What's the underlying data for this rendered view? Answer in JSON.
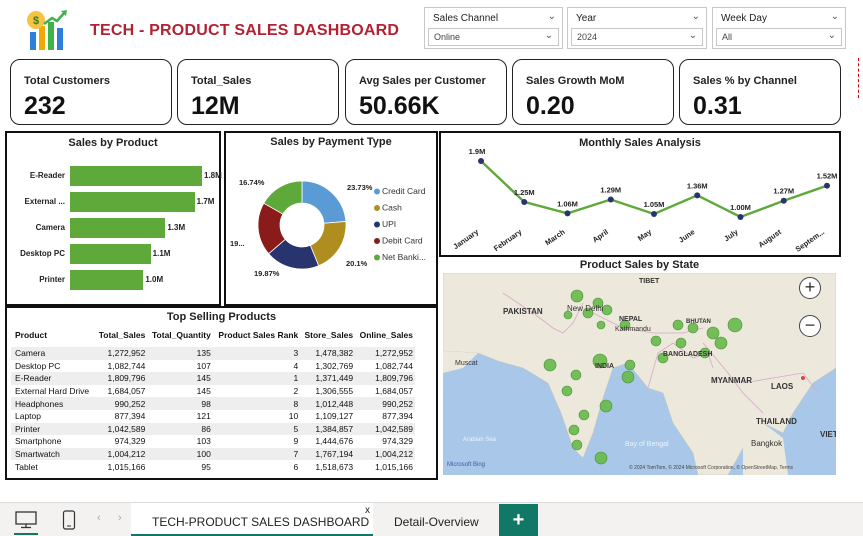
{
  "header": {
    "title": "TECH - PRODUCT SALES DASHBOARD"
  },
  "slicers": [
    {
      "label": "Sales Channel",
      "value": "Online"
    },
    {
      "label": "Year",
      "value": "2024"
    },
    {
      "label": "Week Day",
      "value": "All"
    }
  ],
  "kpis": [
    {
      "label": "Total Customers",
      "value": "232"
    },
    {
      "label": "Total_Sales",
      "value": "12M"
    },
    {
      "label": "Avg Sales per Customer",
      "value": "50.66K"
    },
    {
      "label": "Sales Growth MoM",
      "value": "0.20"
    },
    {
      "label": "Sales % by Channel",
      "value": "0.31"
    }
  ],
  "sales_by_product": {
    "title": "Sales by Product",
    "categories": [
      "E-Reader",
      "External ...",
      "Camera",
      "Desktop PC",
      "Printer"
    ],
    "values": [
      1.8,
      1.7,
      1.3,
      1.1,
      1.0
    ],
    "labels": [
      "1.8M",
      "1.7M",
      "1.3M",
      "1.1M",
      "1.0M"
    ]
  },
  "payment_type": {
    "title": "Sales by Payment Type",
    "slices": [
      {
        "name": "Credit Card",
        "percent": 23.73,
        "label": "23.73%",
        "color": "#5b9bd5"
      },
      {
        "name": "Cash",
        "percent": 20.1,
        "label": "20.1%",
        "color": "#b08d1f"
      },
      {
        "name": "UPI",
        "percent": 19.87,
        "label": "19.87%",
        "color": "#27346d"
      },
      {
        "name": "Debit Card",
        "percent": 19.56,
        "label": "19...",
        "color": "#8b1a1a"
      },
      {
        "name": "Net Banki...",
        "percent": 16.74,
        "label": "16.74%",
        "color": "#5fa83a"
      }
    ]
  },
  "monthly_sales": {
    "title": "Monthly Sales Analysis",
    "months": [
      "January",
      "February",
      "March",
      "April",
      "May",
      "June",
      "July",
      "August",
      "Septem..."
    ],
    "values": [
      1.93,
      1.25,
      1.06,
      1.29,
      1.05,
      1.36,
      1.0,
      1.27,
      1.52
    ],
    "labels": [
      "1.9M",
      "1.25M",
      "1.06M",
      "1.29M",
      "1.05M",
      "1.36M",
      "1.00M",
      "1.27M",
      "1.52M"
    ]
  },
  "top_selling": {
    "title": "Top Selling Products",
    "columns": [
      "Product",
      "Total_Sales",
      "Total_Quantity",
      "Product Sales Rank",
      "Store_Sales",
      "Online_Sales"
    ],
    "rows": [
      [
        "Camera",
        "1,272,952",
        "135",
        "3",
        "1,478,382",
        "1,272,952"
      ],
      [
        "Desktop PC",
        "1,082,744",
        "107",
        "4",
        "1,302,769",
        "1,082,744"
      ],
      [
        "E-Reader",
        "1,809,796",
        "145",
        "1",
        "1,371,449",
        "1,809,796"
      ],
      [
        "External Hard Drive",
        "1,684,057",
        "145",
        "2",
        "1,306,555",
        "1,684,057"
      ],
      [
        "Headphones",
        "990,252",
        "98",
        "8",
        "1,012,448",
        "990,252"
      ],
      [
        "Laptop",
        "877,394",
        "121",
        "10",
        "1,109,127",
        "877,394"
      ],
      [
        "Printer",
        "1,042,589",
        "86",
        "5",
        "1,384,857",
        "1,042,589"
      ],
      [
        "Smartphone",
        "974,329",
        "103",
        "9",
        "1,444,676",
        "974,329"
      ],
      [
        "Smartwatch",
        "1,004,212",
        "100",
        "7",
        "1,767,194",
        "1,004,212"
      ],
      [
        "Tablet",
        "1,015,166",
        "95",
        "6",
        "1,518,673",
        "1,015,166"
      ]
    ]
  },
  "map": {
    "title": "Product Sales by State",
    "place_labels": [
      "PAKISTAN",
      "TIBET",
      "New Delhi",
      "Kathmandu",
      "NEPAL",
      "BHUTAN",
      "BANGLADESH",
      "INDIA",
      "Muscat",
      "MYANMAR",
      "LAOS",
      "THAILAND",
      "VIETNA",
      "Bangkok",
      "Arabian Sea",
      "Bay of Bengal"
    ],
    "attribution": "© 2024 TomTom, © 2024 Microsoft Corporation, © OpenStreetMap, Terms",
    "brand": "Microsoft Bing"
  },
  "tabs": {
    "active": "TECH-PRODUCT SALES DASHBOARD",
    "second": "Detail-Overview",
    "add": "+",
    "close": "x"
  }
}
